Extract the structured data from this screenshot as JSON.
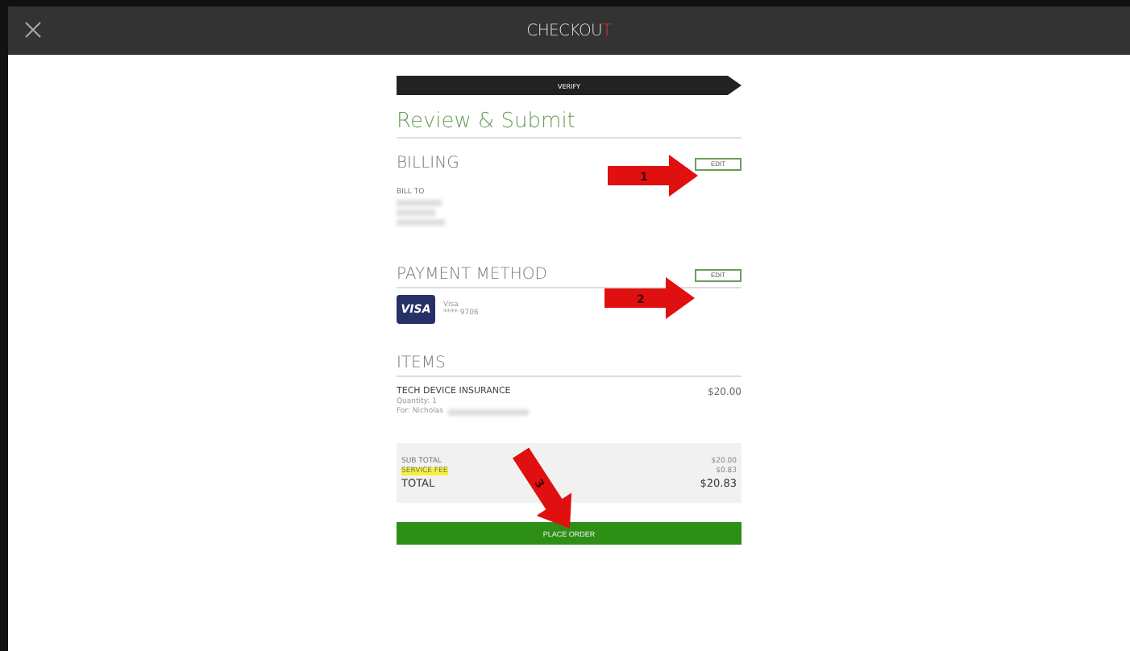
{
  "header": {
    "title": "CHECKOU",
    "title_accent": "T"
  },
  "step": "VERIFY",
  "heading": "Review & Submit",
  "billing": {
    "title": "BILLING",
    "edit": "EDIT",
    "label": "BILL TO"
  },
  "payment": {
    "title": "PAYMENT METHOD",
    "edit": "EDIT",
    "card_logo": "VISA",
    "card_name": "Visa",
    "card_number": "**** 9706"
  },
  "items": {
    "title": "ITEMS",
    "rows": [
      {
        "name": "TECH DEVICE INSURANCE",
        "price": "$20.00",
        "quantity": "Quantity: 1",
        "for": "For: Nicholas"
      }
    ]
  },
  "totals": [
    {
      "label": "SUB TOTAL",
      "value": "$20.00",
      "highlighted": false,
      "kind": "small"
    },
    {
      "label": "SERVICE FEE",
      "value": "$0.83",
      "highlighted": true,
      "kind": "small"
    },
    {
      "label": "TOTAL",
      "value": "$20.83",
      "highlighted": false,
      "kind": "large"
    }
  ],
  "place_order": "PLACE ORDER",
  "annotations": [
    {
      "label": "1",
      "kind": "right"
    },
    {
      "label": "2",
      "kind": "right"
    },
    {
      "label": "3",
      "kind": "down"
    }
  ]
}
